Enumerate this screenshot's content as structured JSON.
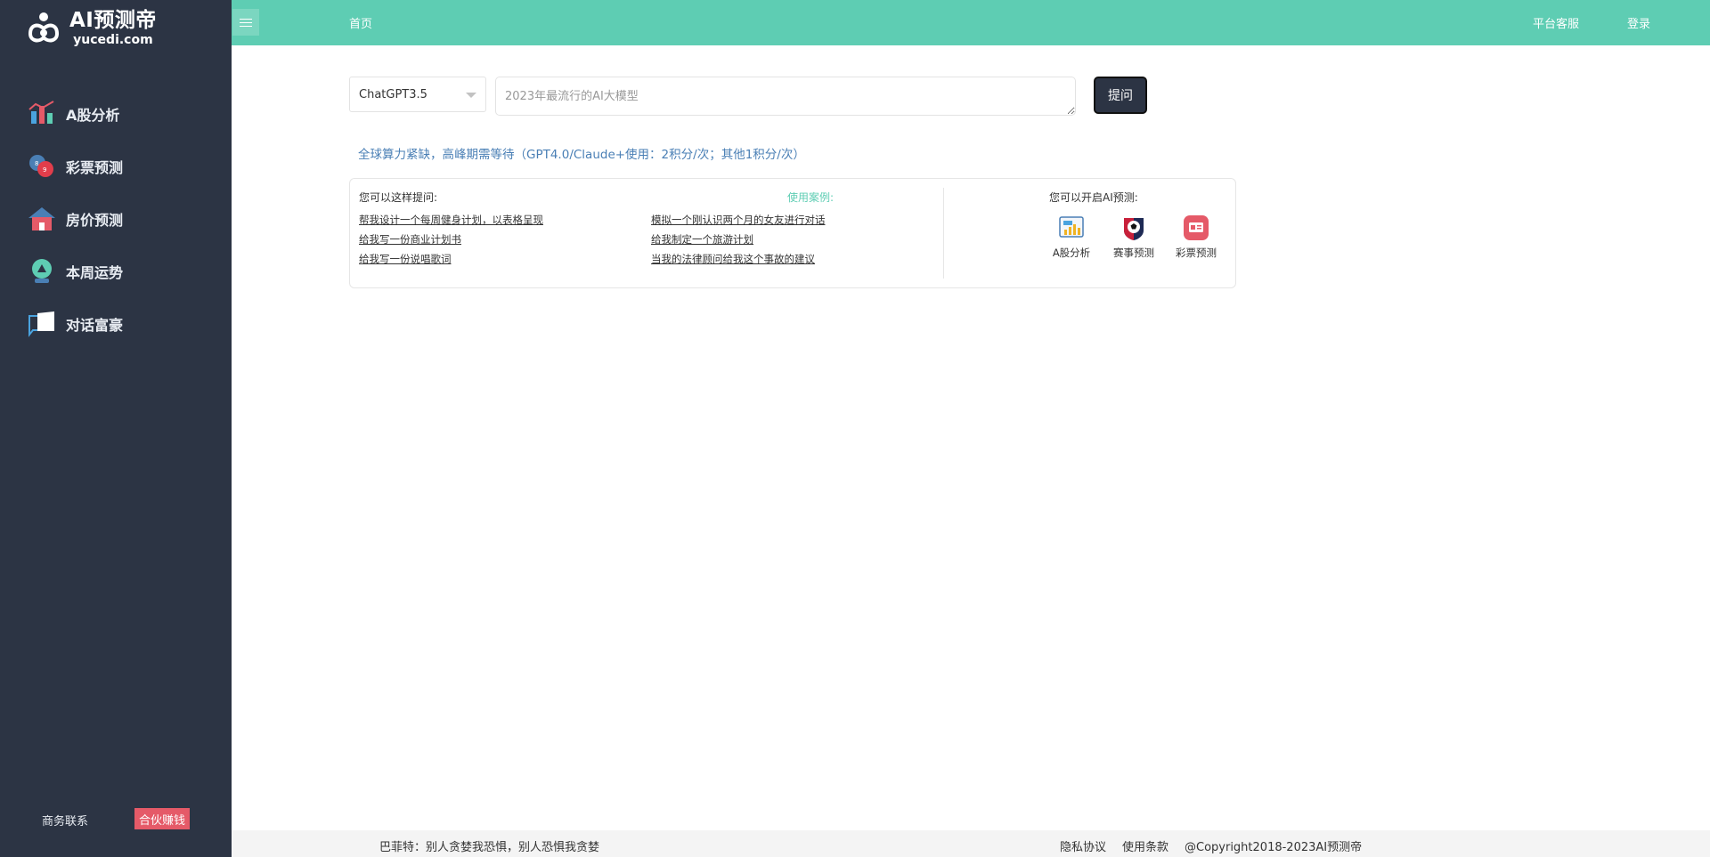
{
  "brand": {
    "title": "AI预测帝",
    "subtitle": "yucedi.com"
  },
  "sidebar": {
    "items": [
      {
        "label": "A股分析",
        "icon": "stock-chart-icon"
      },
      {
        "label": "彩票预测",
        "icon": "lottery-balls-icon"
      },
      {
        "label": "房价预测",
        "icon": "house-icon"
      },
      {
        "label": "本周运势",
        "icon": "crystal-ball-icon"
      },
      {
        "label": "对话富豪",
        "icon": "chat-bubble-icon"
      }
    ],
    "footer": {
      "business": "商务联系",
      "partner": "合伙赚钱"
    }
  },
  "topbar": {
    "home": "首页",
    "support": "平台客服",
    "login": "登录"
  },
  "ask": {
    "model": "ChatGPT3.5",
    "placeholder": "2023年最流行的AI大模型",
    "button": "提问"
  },
  "notice": "全球算力紧缺，高峰期需等待（GPT4.0/Claude+使用：2积分/次；其他1积分/次）",
  "suggestions": {
    "heading": "您可以这样提问:",
    "cases_link": "使用案例:",
    "items": [
      "帮我设计一个每周健身计划，以表格呈现",
      "模拟一个刚认识两个月的女友进行对话",
      "给我写一份商业计划书",
      "给我制定一个旅游计划",
      "给我写一份说唱歌词",
      "当我的法律顾问给我这个事故的建议"
    ]
  },
  "predictions": {
    "heading": "您可以开启AI预测:",
    "items": [
      {
        "label": "A股分析",
        "icon": "stock-board-icon"
      },
      {
        "label": "赛事预测",
        "icon": "soccer-ball-icon"
      },
      {
        "label": "彩票预测",
        "icon": "lottery-ticket-icon"
      }
    ]
  },
  "footer": {
    "quote": "巴菲特：别人贪婪我恐惧，别人恐惧我贪婪",
    "privacy": "隐私协议",
    "terms": "使用条款",
    "copyright": "@Copyright2018-2023AI预测帝"
  },
  "colors": {
    "sidebar_bg": "#2c3444",
    "topbar_bg": "#5ecdb3",
    "partner_btn": "#e55a68",
    "notice_text": "#4a7fb5"
  }
}
